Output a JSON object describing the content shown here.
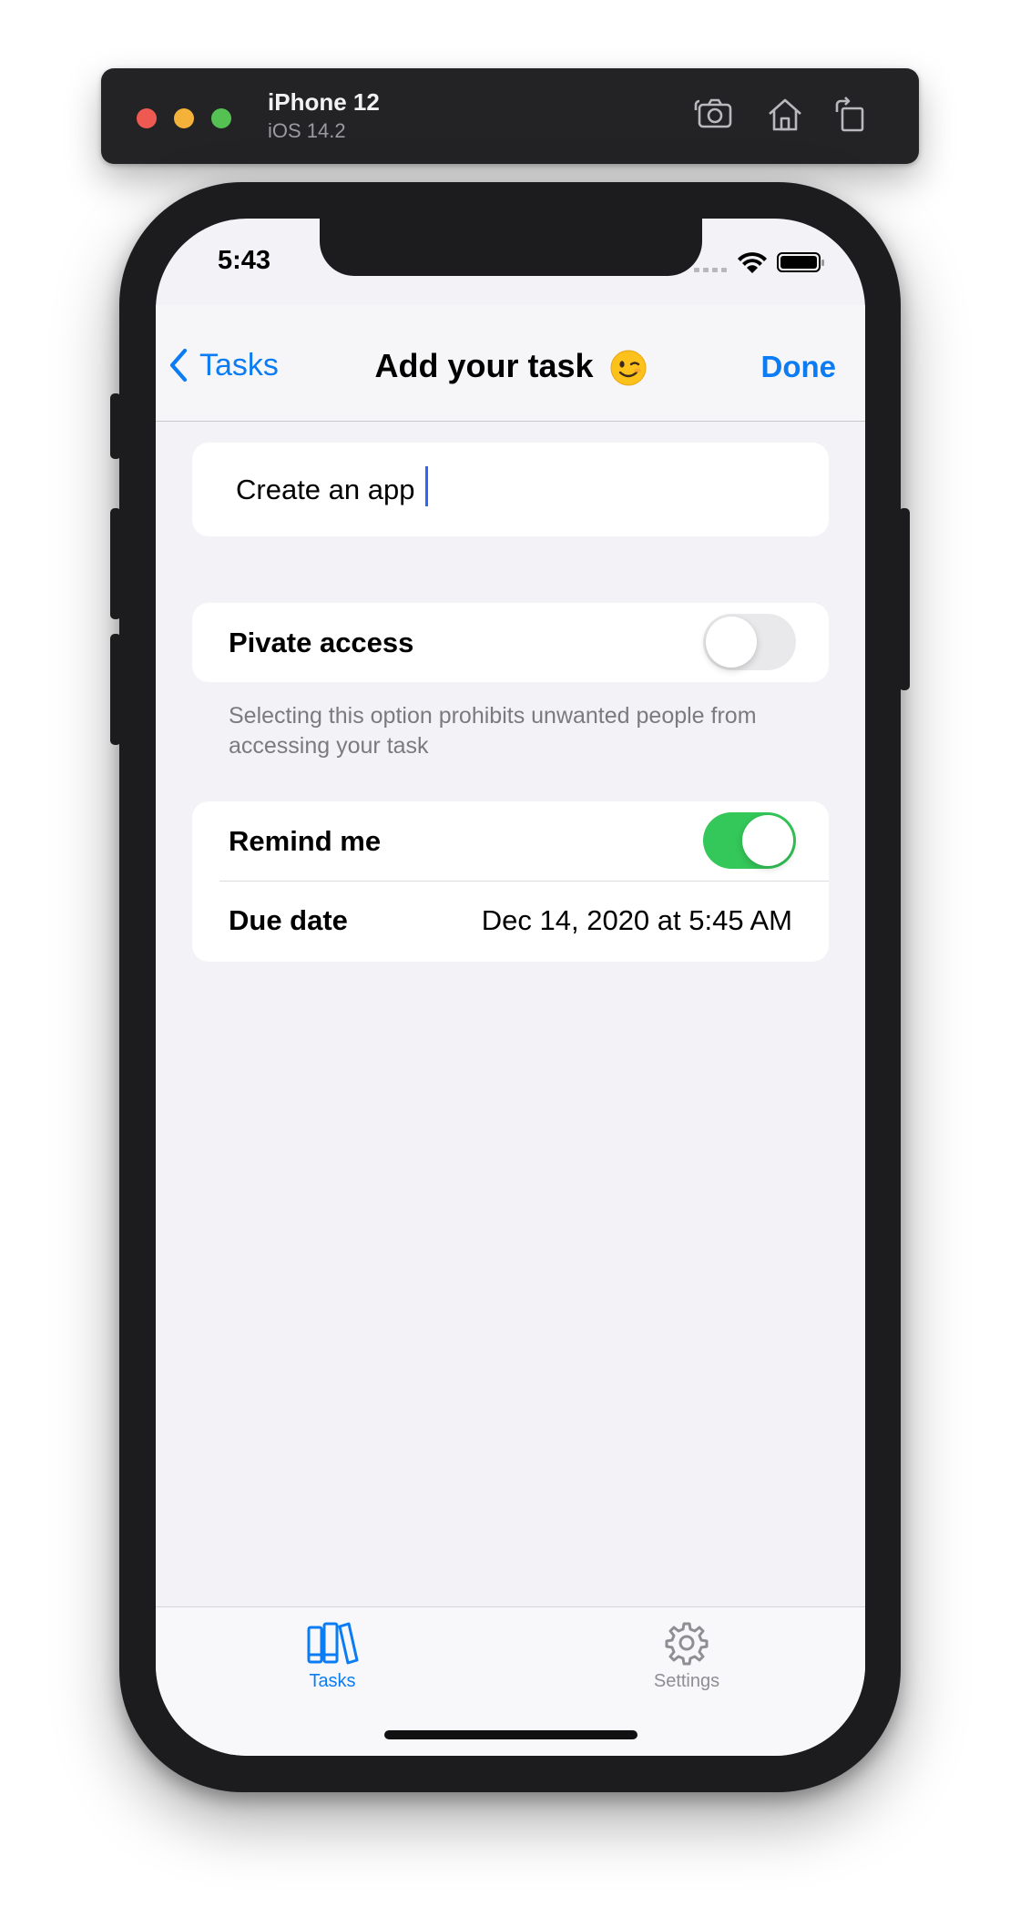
{
  "simulator": {
    "device_name": "iPhone 12",
    "os_version": "iOS 14.2",
    "toolbar_icons": [
      "screenshot-icon",
      "home-icon",
      "rotate-icon"
    ]
  },
  "status_bar": {
    "time": "5:43"
  },
  "nav": {
    "back_label": "Tasks",
    "title": "Add your task",
    "title_emoji": "winking-face-emoji",
    "done_label": "Done"
  },
  "form": {
    "task_name_value": "Create an app",
    "private_access": {
      "label": "Pivate access",
      "enabled": false,
      "footer": "Selecting this option prohibits unwanted people from accessing your task"
    },
    "remind_me": {
      "label": "Remind me",
      "enabled": true
    },
    "due_date": {
      "label": "Due date",
      "value": "Dec 14, 2020 at 5:45 AM"
    }
  },
  "tabbar": {
    "tabs": [
      {
        "label": "Tasks",
        "icon": "books-icon",
        "selected": true
      },
      {
        "label": "Settings",
        "icon": "gear-icon",
        "selected": false
      }
    ]
  },
  "colors": {
    "accent": "#0b7cf3",
    "toggle_on": "#34c759",
    "inactive_tab": "#8e8e93"
  }
}
